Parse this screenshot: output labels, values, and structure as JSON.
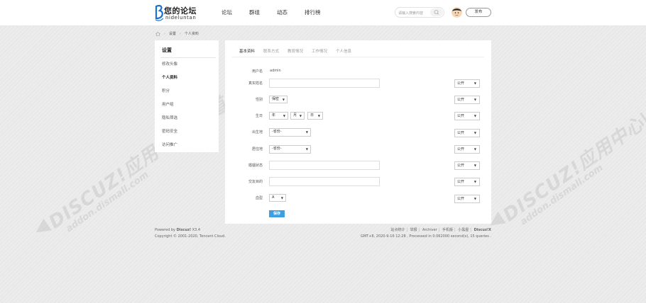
{
  "header": {
    "logo_cn": "您的论坛",
    "logo_en": "nideluntan",
    "nav": [
      "论坛",
      "群组",
      "动态",
      "排行榜"
    ],
    "search_placeholder": "请输入搜索内容",
    "publish_label": "发布"
  },
  "breadcrumb": [
    "设置",
    "个人资料"
  ],
  "sidebar": {
    "title": "设置",
    "items": [
      "修改头像",
      "个人资料",
      "积分",
      "用户组",
      "隐私筛选",
      "密码安全",
      "访问推广"
    ]
  },
  "tabs": [
    "基本资料",
    "联系方式",
    "教育情况",
    "工作情况",
    "个人信息"
  ],
  "form": {
    "username_label": "用户名",
    "username_value": "admin",
    "realname_label": "真实姓名",
    "gender_label": "性别",
    "gender_value": "保密",
    "birthday_label": "生日",
    "birth_year": "年",
    "birth_month": "月",
    "birth_day": "日",
    "birthplace_label": "出生地",
    "birthplace_value": "-省份-",
    "residence_label": "居住地",
    "residence_value": "-省份-",
    "marital_label": "婚姻状态",
    "purpose_label": "交友目的",
    "blood_label": "血型",
    "blood_value": "A",
    "privacy_value": "公开",
    "save_label": "保存"
  },
  "footer": {
    "powered_prefix": "Powered by ",
    "powered_brand": "Discuz!",
    "powered_version": " X3.4",
    "copyright": "Copyright © 2001-2020, Tencent Cloud.",
    "links": [
      "站点统计",
      "举报",
      "Archiver",
      "手机版",
      "小黑屋"
    ],
    "brand": "Discuz!X",
    "stats": "GMT+8, 2020-9-16 12:28 , Processed in 0.062000 second(s), 15 queries ."
  },
  "watermark": {
    "big": "DISCUZ!应用中心|贰道",
    "small": "addon.dismall.com"
  },
  "colors": {
    "accent": "#3d9ee0",
    "background": "#ececec"
  }
}
